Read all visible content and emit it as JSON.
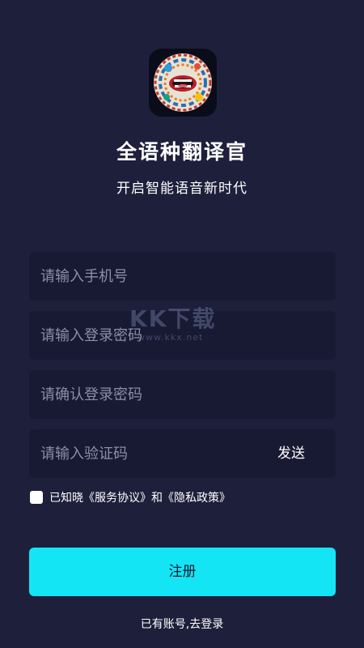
{
  "app": {
    "title": "全语种翻译官",
    "subtitle": "开启智能语音新时代",
    "logo_icon": "app-logo-mouth-icon"
  },
  "form": {
    "phone_placeholder": "请输入手机号",
    "password_placeholder": "请输入登录密码",
    "confirm_password_placeholder": "请确认登录密码",
    "code_placeholder": "请输入验证码",
    "send_label": "发送"
  },
  "agreement": {
    "prefix": "已知晓",
    "service_label": "《服务协议》",
    "and": "和",
    "privacy_label": "《隐私政策》",
    "checked": false
  },
  "buttons": {
    "register_label": "注册",
    "login_link": "已有账号,去登录"
  },
  "watermark": {
    "big": "KK下载",
    "small": "www.kkx.net"
  },
  "colors": {
    "background": "#1e1f3b",
    "field": "#181933",
    "accent": "#13e5f5"
  }
}
